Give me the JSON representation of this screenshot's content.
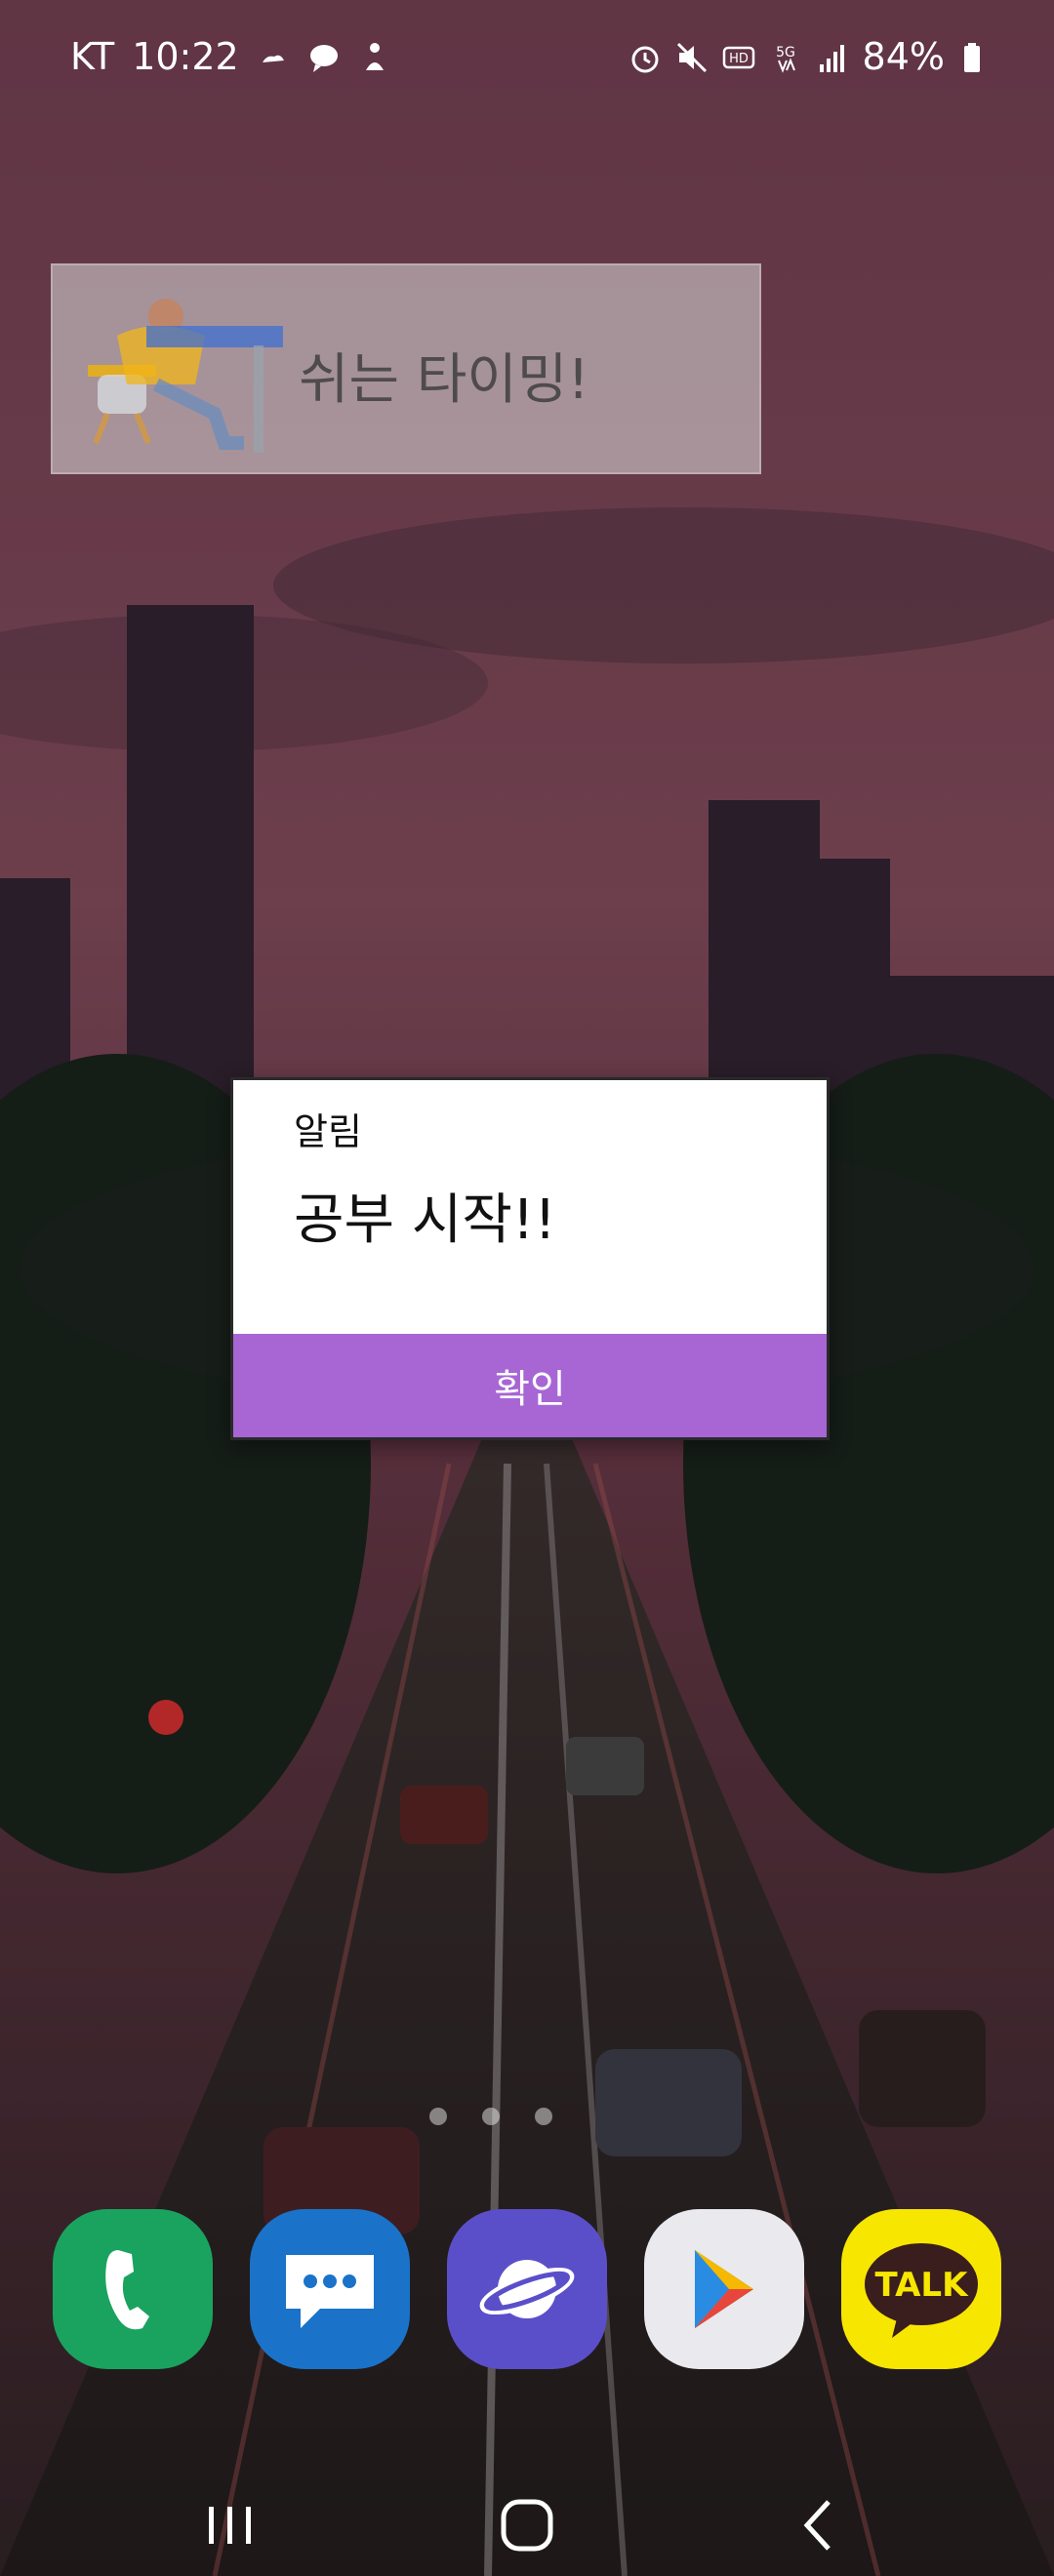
{
  "status_bar": {
    "carrier": "KT",
    "time": "10:22",
    "battery": "84%",
    "left_icons": [
      "weather-icon",
      "chat-bubble-icon",
      "accessibility-icon"
    ],
    "right_icons": [
      "alarm-icon",
      "mute-icon",
      "hd-icon",
      "5g-icon",
      "signal-icon",
      "battery-icon"
    ]
  },
  "widget": {
    "text": "쉬는 타이밍!"
  },
  "dialog": {
    "title": "알림",
    "message": "공부 시작!!",
    "confirm_label": "확인",
    "button_color": "#a766d4"
  },
  "dock": {
    "apps": [
      {
        "name": "phone",
        "color": "#1aa35f"
      },
      {
        "name": "messages",
        "color": "#1a73c9"
      },
      {
        "name": "samsung-internet",
        "color": "#5b4fc9"
      },
      {
        "name": "play-store",
        "color": "#e9e9ee"
      },
      {
        "name": "kakaotalk",
        "color": "#f7e600",
        "label": "TALK"
      }
    ]
  },
  "navigation": {
    "buttons": [
      "recents-icon",
      "home-icon",
      "back-icon"
    ]
  }
}
